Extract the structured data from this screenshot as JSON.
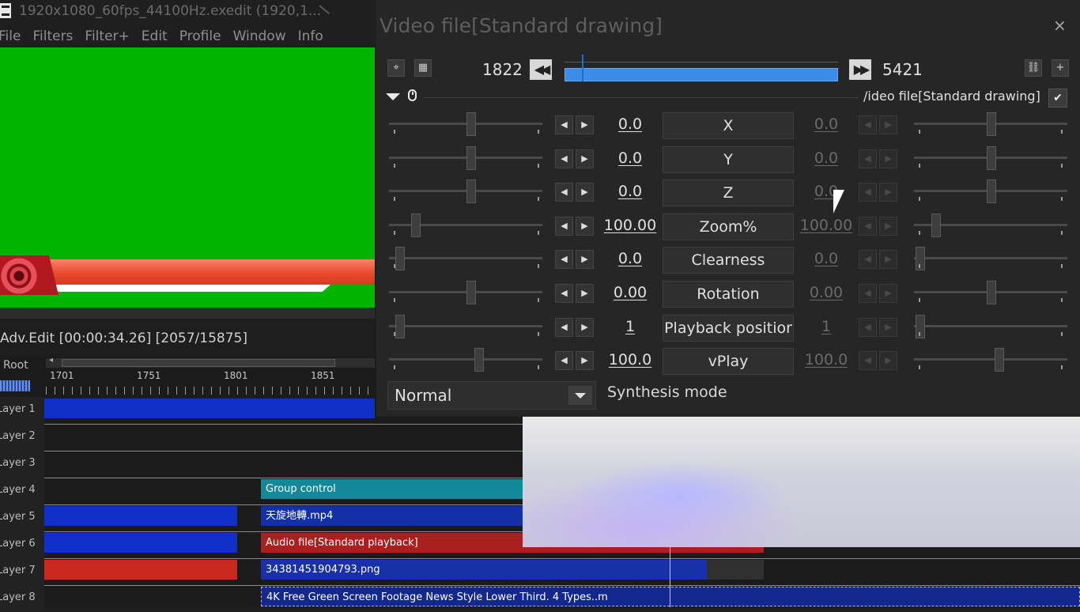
{
  "main_window": {
    "title": "1920x1080_60fps_44100Hz.exedit (1920,1...",
    "menu": [
      "File",
      "Filters",
      "Filter+",
      "Edit",
      "Profile",
      "Window",
      "Info"
    ]
  },
  "timeline": {
    "title": "Adv.Edit [00:00:34.26] [2057/15875]",
    "root_label": "Root",
    "ticks": [
      "1701",
      "1751",
      "1801",
      "1851"
    ],
    "layers": [
      "Layer 1",
      "Layer 2",
      "Layer 3",
      "Layer 4",
      "Layer 5",
      "Layer 6",
      "Layer 7",
      "Layer 8"
    ],
    "clips": {
      "group_control": "Group control",
      "video_clip": "天旋地轉.mp4",
      "audio_clip": "Audio file[Standard playback]",
      "image_clip": "34381451904793.png",
      "lower_third_clip": "4K Free Green Screen Footage News Style Lower Third. 4 Types..m"
    },
    "colors": {
      "blue_clip": "#1230c8",
      "red_clip": "#c8281e",
      "teal_clip": "#12889a"
    }
  },
  "dialog": {
    "title": "Video file[Standard drawing]",
    "close_glyph": "×",
    "frame_start": "1822",
    "frame_end": "5421",
    "seek_fraction": 0.06,
    "object_name": "/ideo file[Standard drawing]",
    "params": [
      {
        "name": "X",
        "left": "0.0",
        "right": "0.0"
      },
      {
        "name": "Y",
        "left": "0.0",
        "right": "0.0"
      },
      {
        "name": "Z",
        "left": "0.0",
        "right": "0.0"
      },
      {
        "name": "Zoom%",
        "left": "100.00",
        "right": "100.00"
      },
      {
        "name": "Clearness",
        "left": "0.0",
        "right": "0.0"
      },
      {
        "name": "Rotation",
        "left": "0.00",
        "right": "0.00"
      },
      {
        "name": "Playback positior",
        "left": "1",
        "right": "1"
      },
      {
        "name": "vPlay",
        "left": "100.0",
        "right": "100.0"
      }
    ],
    "blend_mode": "Normal",
    "blend_label": "Synthesis mode"
  }
}
